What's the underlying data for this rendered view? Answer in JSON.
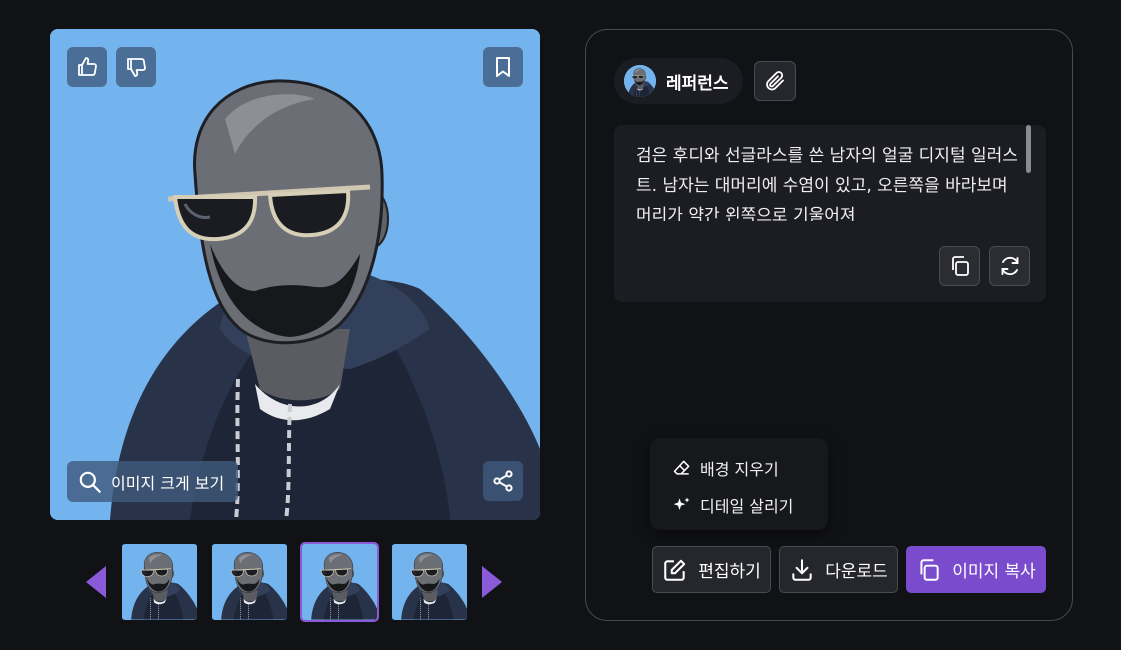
{
  "image_card": {
    "zoom_label": "이미지 크게 보기",
    "icons": {
      "like": "thumbs-up-icon",
      "dislike": "thumbs-down-icon",
      "bookmark": "bookmark-icon",
      "zoom": "search-icon",
      "share": "share-icon"
    },
    "background_color": "#74b4ee"
  },
  "thumbnails": {
    "count": 4,
    "selected_index": 2,
    "prev_icon": "triangle-left-icon",
    "next_icon": "triangle-right-icon"
  },
  "panel": {
    "reference_label": "레퍼런스",
    "prompt_text": "검은 후디와 선글라스를 쓴 남자의 얼굴 디지털 일러스트. 남자는 대머리에 수염이 있고, 오른쪽을 바라보며 머리가 약간 왼쪽으로 기울어져",
    "menu": {
      "remove_background": "배경 지우기",
      "enhance_details": "디테일 살리기"
    },
    "actions": {
      "edit": "편집하기",
      "download": "다운로드",
      "copy_image": "이미지 복사"
    }
  },
  "colors": {
    "accent": "#7b4bcd",
    "page_background": "#111216",
    "panel_surface": "#1c1d22"
  }
}
